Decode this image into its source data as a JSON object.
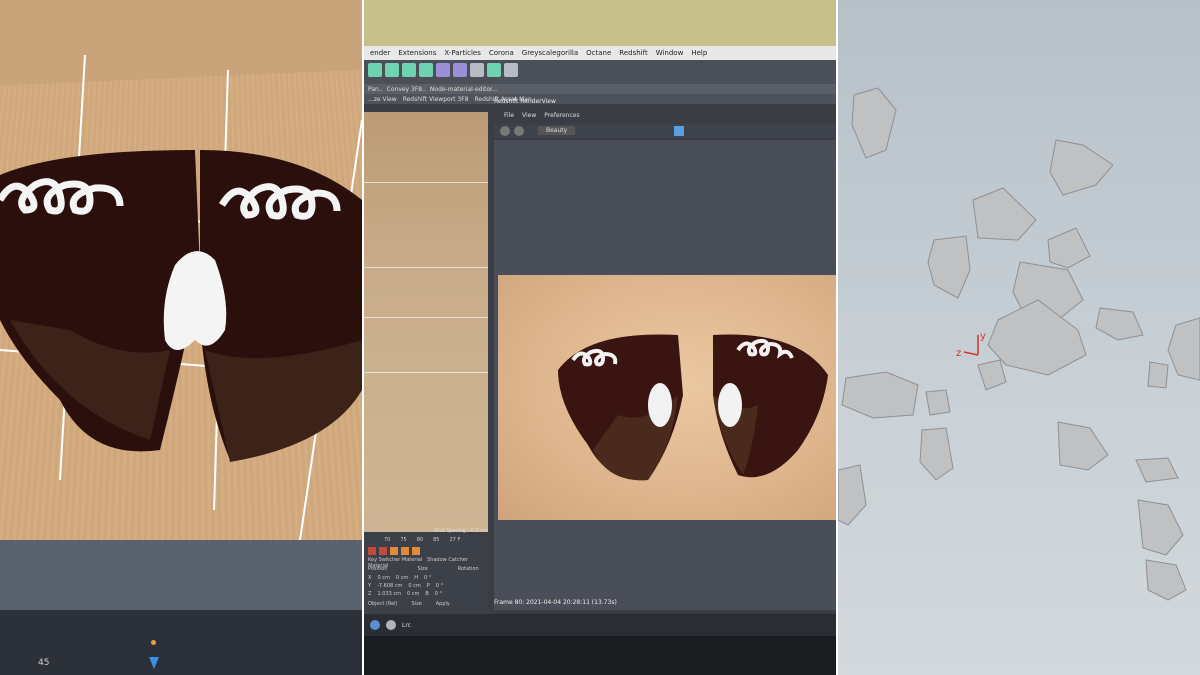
{
  "left": {
    "tick_label": "45"
  },
  "app": {
    "menu": [
      "ender",
      "Extensions",
      "X-Particles",
      "Corona",
      "Greyscalegorilla",
      "Octane",
      "Redshift",
      "Window",
      "Help"
    ],
    "doc_tabs": [
      "Pan..",
      "Convey 3F8..",
      "Node-material-editor..."
    ],
    "view_tabs": [
      "...ze View",
      "Redshift Viewport 3F8",
      "Redshift Asset Man"
    ],
    "renderview_title": "Redshift RenderView",
    "renderview_menu": [
      "File",
      "View",
      "Preferences"
    ],
    "renderview_dropdown": "Beauty",
    "grid_spacing": "Grid Spacing : 0.5 cm",
    "timeline_numbers": [
      "70",
      "75",
      "80",
      "85",
      "27 F"
    ],
    "attr_title": "Key Switcher Material",
    "attr_title2": "Shadow Catcher Material",
    "attr_headers": [
      "Position",
      "Size",
      "Rotation"
    ],
    "attr_rows": [
      {
        "axis": "X",
        "pos": "0 cm",
        "size": "0 cm",
        "rot_label": "H",
        "rot": "0 °"
      },
      {
        "axis": "Y",
        "pos": "-7.608 cm",
        "size": "0 cm",
        "rot_label": "P",
        "rot": "0 °"
      },
      {
        "axis": "Z",
        "pos": "1.033 cm",
        "size": "0 cm",
        "rot_label": "B",
        "rot": "0 °"
      }
    ],
    "attr_object_mode": "Object (Rel)",
    "attr_size_mode": "Size",
    "attr_apply": "Apply",
    "frame_info": "Frame  80:  2021-04-04  20:28:11  (13.73s)",
    "bottom_tab": "Lrc"
  },
  "right": {
    "axis_y": "y",
    "axis_z": "z"
  },
  "colors": {
    "chocolate": "#3a1410",
    "cream": "#f2f2f2",
    "render_bg": "#ddb48c",
    "rock": "#bfc1c3"
  }
}
